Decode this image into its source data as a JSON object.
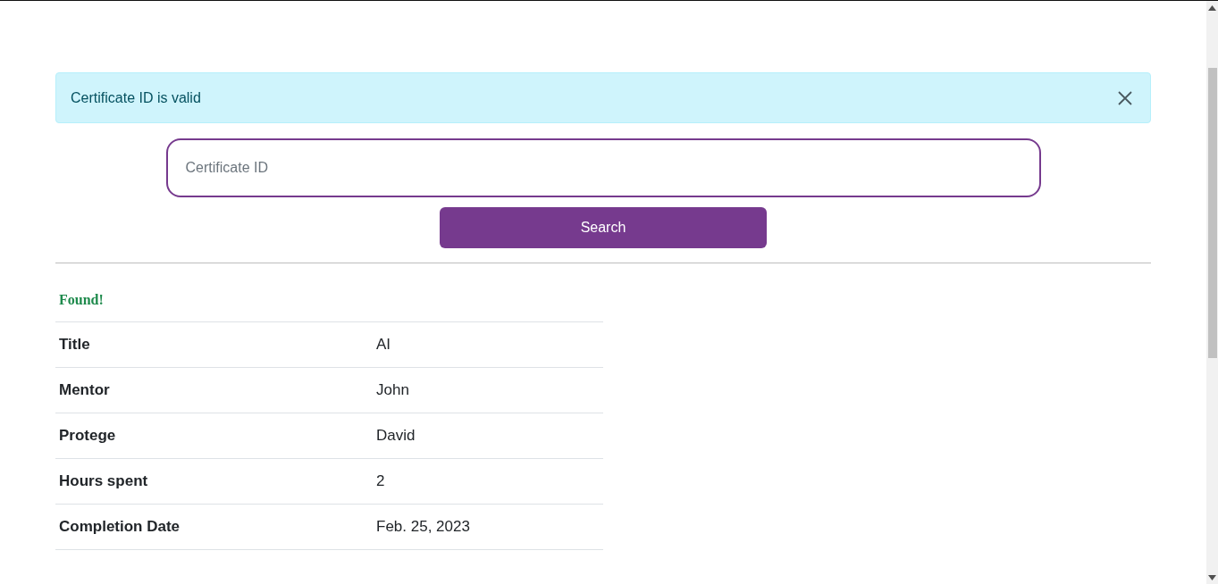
{
  "alert": {
    "message": "Certificate ID is valid"
  },
  "search": {
    "placeholder": "Certificate ID",
    "button": "Search"
  },
  "result": {
    "status": "Found!",
    "rows": [
      {
        "label": "Title",
        "value": "AI"
      },
      {
        "label": "Mentor",
        "value": "John"
      },
      {
        "label": "Protege",
        "value": "David"
      },
      {
        "label": "Hours spent",
        "value": "2"
      },
      {
        "label": "Completion Date",
        "value": "Feb. 25, 2023"
      }
    ]
  }
}
